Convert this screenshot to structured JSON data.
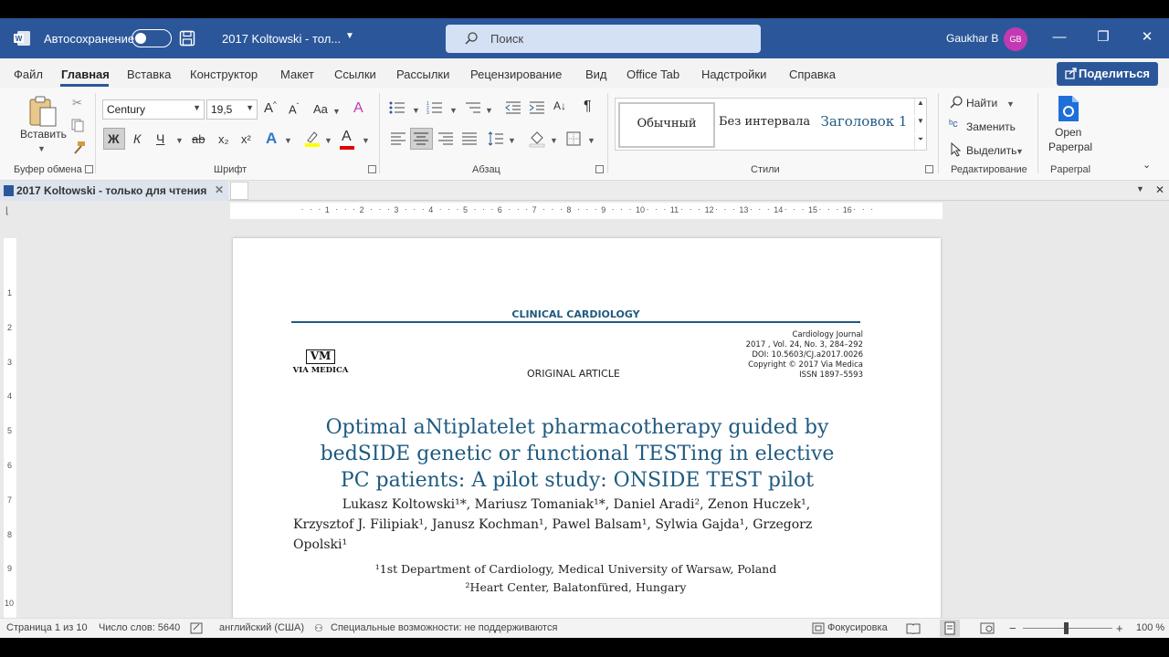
{
  "titlebar": {
    "autosave_label": "Автосохранение",
    "doc_title": "2017 Koltowski  -  тол...",
    "search_placeholder": "Поиск",
    "user_name": "Gaukhar B",
    "user_initials": "GB",
    "minimize": "—",
    "restore": "❐",
    "close": "✕"
  },
  "menu": {
    "items": [
      "Файл",
      "Главная",
      "Вставка",
      "Конструктор",
      "Макет",
      "Ссылки",
      "Рассылки",
      "Рецензирование",
      "Вид",
      "Office Tab",
      "Надстройки",
      "Справка"
    ],
    "active": "Главная",
    "share_label": "Поделиться"
  },
  "ribbon": {
    "clipboard": {
      "paste_label": "Вставить",
      "group_label": "Буфер обмена"
    },
    "font": {
      "font_name": "Century",
      "font_size": "19,5",
      "case_label": "Aa",
      "bold": "Ж",
      "italic": "К",
      "underline": "Ч",
      "strike": "ab",
      "subscript": "x₂",
      "superscript": "x²",
      "effects": "A",
      "color_letter": "A",
      "group_label": "Шрифт"
    },
    "paragraph": {
      "group_label": "Абзац"
    },
    "styles": {
      "items": [
        "Обычный",
        "Без интервала",
        "Заголовок 1"
      ],
      "group_label": "Стили"
    },
    "editing": {
      "find": "Найти",
      "replace": "Заменить",
      "select": "Выделить",
      "group_label": "Редактирование"
    },
    "paperpal": {
      "open_label": "Open",
      "open_label2": "Paperpal",
      "group_label": "Paperpal"
    }
  },
  "tabstrip": {
    "tab_label": "2017 Koltowski  -  только для чтения"
  },
  "ruler": {
    "h_numbers": [
      "1",
      "2",
      "3",
      "4",
      "5",
      "6",
      "7",
      "8",
      "9",
      "10",
      "11",
      "12",
      "13",
      "14",
      "15",
      "16"
    ],
    "v_numbers": [
      "1",
      "2",
      "3",
      "4",
      "5",
      "6",
      "7",
      "8",
      "9",
      "10"
    ]
  },
  "document": {
    "journal_header": "CLINICAL CARDIOLOGY",
    "logo_letters": "VM",
    "logo_text": "VIA MEDICA",
    "article_type": "ORIGINAL  ARTICLE",
    "meta": [
      "Cardiology  Journal",
      "2017 , Vol. 24,  No. 3, 284–292",
      "DOI:  10.5603/CJ.a2017.0026",
      "Copyright  © 2017  Via Medica",
      "ISSN  1897–5593"
    ],
    "title_lines": [
      "Optimal aNtiplatelet pharmacotherapy guided by",
      "bedSIDE genetic or functional TESTing in elective",
      "PC patients: A pilot study: ONSIDE TEST pilot"
    ],
    "authors_line1": "Lukasz Koltowski¹*, Mariusz Tomaniak¹*, Daniel Aradi², Zenon Huczek¹,",
    "authors_line2": "Krzysztof J. Filipiak¹, Janusz Kochman¹, Pawel Balsam¹, Sylwia Gajda¹, Grzegorz",
    "authors_line3": "Opolski¹",
    "affiliation1": "¹1st Department of Cardiology, Medical University of Warsaw, Poland",
    "affiliation2": "²Heart Center, Balatonfüred, Hungary"
  },
  "status": {
    "page": "Страница 1 из 10",
    "words": "Число слов: 5640",
    "language": "английский (США)",
    "accessibility": "Специальные возможности: не поддерживаются",
    "focus": "Фокусировка",
    "zoom_minus": "−",
    "zoom_plus": "+",
    "zoom": "100 %"
  },
  "colors": {
    "word_blue": "#2b579a",
    "title_blue": "#1f5a80",
    "avatar": "#c239b3"
  }
}
